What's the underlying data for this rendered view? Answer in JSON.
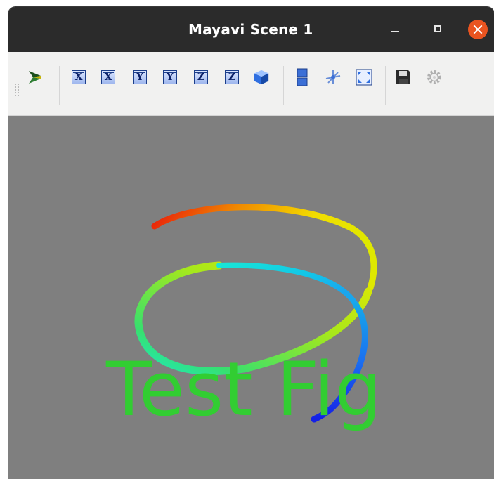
{
  "window": {
    "title": "Mayavi Scene 1"
  },
  "toolbar": {
    "buttons": [
      {
        "name": "mayavi-logo-button",
        "icon": "mayavi-logo-icon"
      },
      {
        "name": "view-x-plus-button",
        "label": "X"
      },
      {
        "name": "view-x-minus-button",
        "label": "X"
      },
      {
        "name": "view-y-plus-button",
        "label": "Y"
      },
      {
        "name": "view-y-minus-button",
        "label": "Y"
      },
      {
        "name": "view-z-plus-button",
        "label": "Z"
      },
      {
        "name": "view-z-minus-button",
        "label": "Z"
      },
      {
        "name": "isometric-view-button",
        "icon": "cube-icon"
      },
      {
        "name": "parallel-projection-button",
        "icon": "projection-icon"
      },
      {
        "name": "show-axes-button",
        "icon": "axes-icon"
      },
      {
        "name": "full-screen-button",
        "icon": "fullscreen-icon"
      },
      {
        "name": "save-button",
        "icon": "floppy-disk-icon"
      },
      {
        "name": "settings-button",
        "icon": "gear-icon"
      }
    ]
  },
  "scene": {
    "background_color": "#7f7f7f",
    "text": "Test Fig",
    "text_color": "#32cd32",
    "curve": "helix colored with jet colormap from blue to red"
  }
}
